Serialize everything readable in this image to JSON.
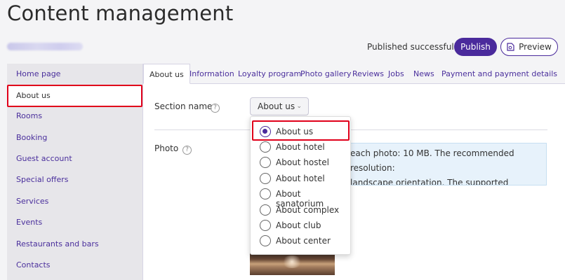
{
  "page": {
    "title": "Content management",
    "link_blurred": "www.hotelsite.com"
  },
  "header": {
    "status": "Published successfully",
    "publish_label": "Publish",
    "preview_label": "Preview",
    "accent_color": "#4a2a9c"
  },
  "sidebar": {
    "items": [
      {
        "label": "Home page"
      },
      {
        "label": "About us",
        "active": true
      },
      {
        "label": "Rooms"
      },
      {
        "label": "Booking"
      },
      {
        "label": "Guest account"
      },
      {
        "label": "Special offers"
      },
      {
        "label": "Services"
      },
      {
        "label": "Events"
      },
      {
        "label": "Restaurants and bars"
      },
      {
        "label": "Contacts"
      }
    ]
  },
  "tabs": [
    {
      "label": "About us",
      "active": true
    },
    {
      "label": "Information"
    },
    {
      "label": "Loyalty program"
    },
    {
      "label": "Photo gallery"
    },
    {
      "label": "Reviews"
    },
    {
      "label": "Jobs"
    },
    {
      "label": "News"
    },
    {
      "label": "Payment and payment details"
    }
  ],
  "form": {
    "section_name_label": "Section name",
    "section_name_value": "About us",
    "photo_label": "Photo",
    "help_glyph": "?",
    "photo_info_lines": [
      "each photo: 10 MB. The recommended resolution:",
      "landscape orientation. The supported formats: JPG,"
    ]
  },
  "dropdown": {
    "options": [
      {
        "label": "About us",
        "selected": true
      },
      {
        "label": "About hotel"
      },
      {
        "label": "About hostel"
      },
      {
        "label": "About hotel"
      },
      {
        "label": "About sanatorium"
      },
      {
        "label": "About complex"
      },
      {
        "label": "About club"
      },
      {
        "label": "About center"
      }
    ]
  },
  "highlight_color": "#e0001a"
}
